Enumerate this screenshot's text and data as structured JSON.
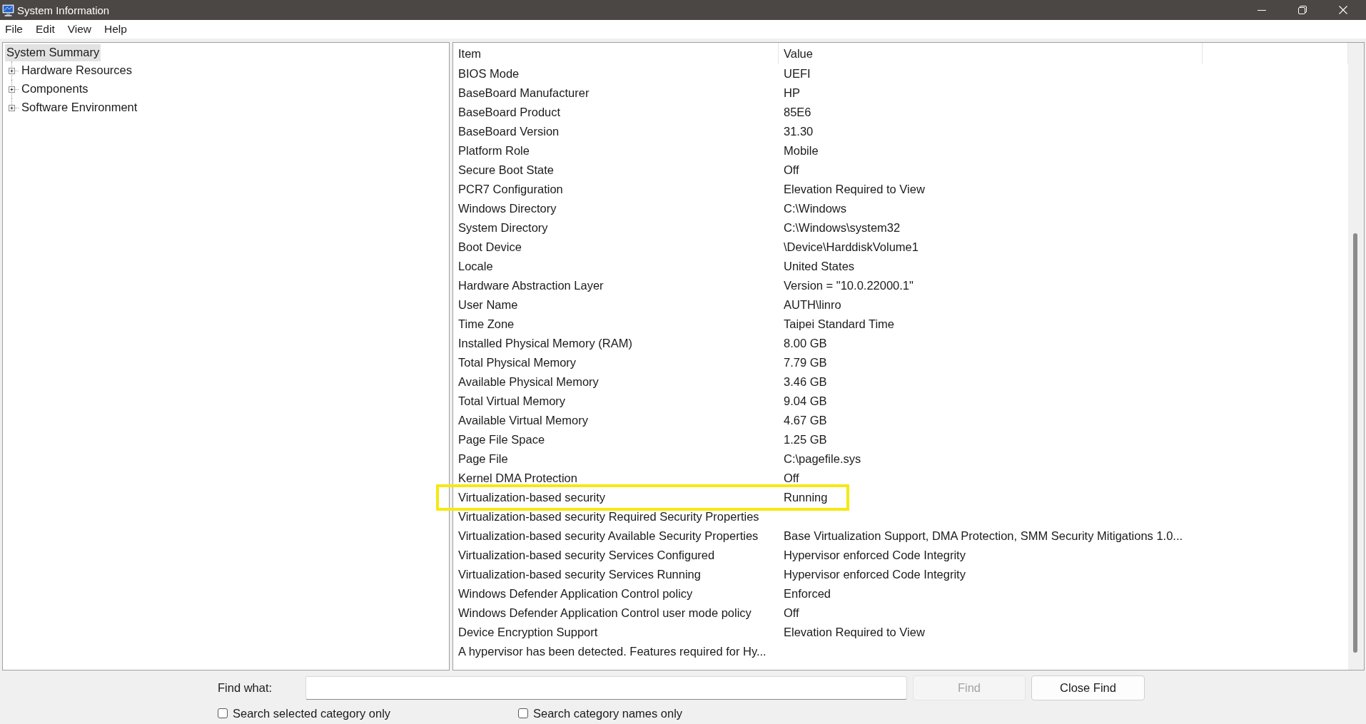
{
  "window": {
    "title": "System Information"
  },
  "menu": [
    "File",
    "Edit",
    "View",
    "Help"
  ],
  "tree": [
    {
      "label": "System Summary",
      "selected": true,
      "children": [
        {
          "label": "Hardware Resources",
          "selected": false,
          "expanded": false
        },
        {
          "label": "Components",
          "selected": false,
          "expanded": false
        },
        {
          "label": "Software Environment",
          "selected": false,
          "expanded": false
        }
      ]
    }
  ],
  "table": {
    "columns": [
      "Item",
      "Value"
    ],
    "rows": [
      {
        "item": "BIOS Mode",
        "value": "UEFI",
        "highlighted": false
      },
      {
        "item": "BaseBoard Manufacturer",
        "value": "HP",
        "highlighted": false
      },
      {
        "item": "BaseBoard Product",
        "value": "85E6",
        "highlighted": false
      },
      {
        "item": "BaseBoard Version",
        "value": "31.30",
        "highlighted": false
      },
      {
        "item": "Platform Role",
        "value": "Mobile",
        "highlighted": false
      },
      {
        "item": "Secure Boot State",
        "value": "Off",
        "highlighted": false
      },
      {
        "item": "PCR7 Configuration",
        "value": "Elevation Required to View",
        "highlighted": false
      },
      {
        "item": "Windows Directory",
        "value": "C:\\Windows",
        "highlighted": false
      },
      {
        "item": "System Directory",
        "value": "C:\\Windows\\system32",
        "highlighted": false
      },
      {
        "item": "Boot Device",
        "value": "\\Device\\HarddiskVolume1",
        "highlighted": false
      },
      {
        "item": "Locale",
        "value": "United States",
        "highlighted": false
      },
      {
        "item": "Hardware Abstraction Layer",
        "value": "Version = \"10.0.22000.1\"",
        "highlighted": false
      },
      {
        "item": "User Name",
        "value": "AUTH\\linro",
        "highlighted": false
      },
      {
        "item": "Time Zone",
        "value": "Taipei Standard Time",
        "highlighted": false
      },
      {
        "item": "Installed Physical Memory (RAM)",
        "value": "8.00 GB",
        "highlighted": false
      },
      {
        "item": "Total Physical Memory",
        "value": "7.79 GB",
        "highlighted": false
      },
      {
        "item": "Available Physical Memory",
        "value": "3.46 GB",
        "highlighted": false
      },
      {
        "item": "Total Virtual Memory",
        "value": "9.04 GB",
        "highlighted": false
      },
      {
        "item": "Available Virtual Memory",
        "value": "4.67 GB",
        "highlighted": false
      },
      {
        "item": "Page File Space",
        "value": "1.25 GB",
        "highlighted": false
      },
      {
        "item": "Page File",
        "value": "C:\\pagefile.sys",
        "highlighted": false
      },
      {
        "item": "Kernel DMA Protection",
        "value": "Off",
        "highlighted": false
      },
      {
        "item": "Virtualization-based security",
        "value": "Running",
        "highlighted": true
      },
      {
        "item": "Virtualization-based security Required Security Properties",
        "highlighted": false
      },
      {
        "item": "Virtualization-based security Available Security Properties",
        "value": "Base Virtualization Support, DMA Protection, SMM Security Mitigations 1.0...",
        "highlighted": false
      },
      {
        "item": "Virtualization-based security Services Configured",
        "value": "Hypervisor enforced Code Integrity",
        "highlighted": false
      },
      {
        "item": "Virtualization-based security Services Running",
        "value": "Hypervisor enforced Code Integrity",
        "highlighted": false
      },
      {
        "item": "Windows Defender Application Control policy",
        "value": "Enforced",
        "highlighted": false
      },
      {
        "item": "Windows Defender Application Control user mode policy",
        "value": "Off",
        "highlighted": false
      },
      {
        "item": "Device Encryption Support",
        "value": "Elevation Required to View",
        "highlighted": false
      },
      {
        "item": "A hypervisor has been detected. Features required for Hy...",
        "highlighted": false
      }
    ]
  },
  "find_bar": {
    "label": "Find what:",
    "buttons": [
      {
        "label": "Find",
        "disabled": true
      },
      {
        "label": "Close Find",
        "disabled": false
      }
    ],
    "options": [
      {
        "label": "Search selected category only",
        "checked": false
      },
      {
        "label": "Search category names only",
        "checked": false
      }
    ]
  }
}
